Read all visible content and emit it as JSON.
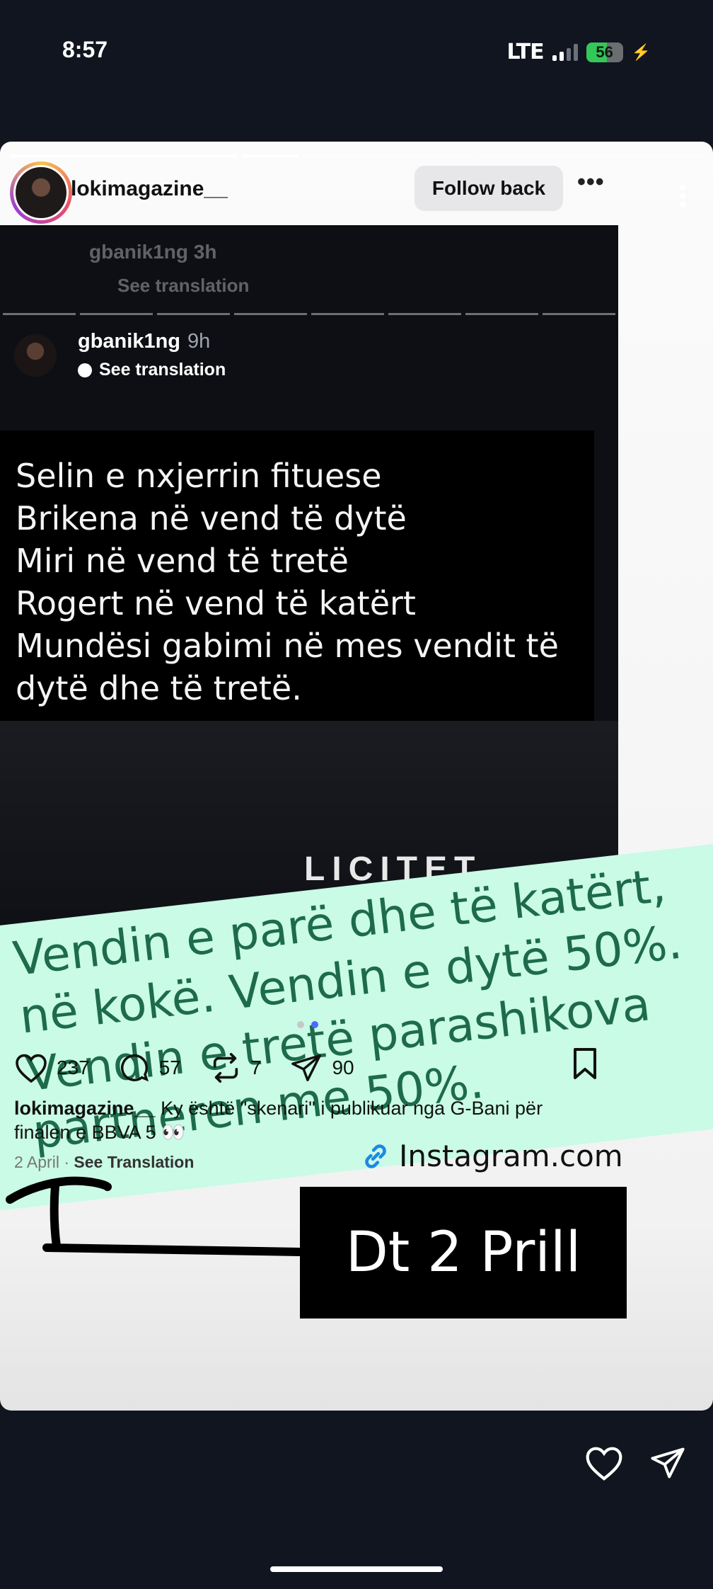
{
  "status_bar": {
    "time": "8:57",
    "network": "LTE",
    "battery": "56"
  },
  "story": {
    "username": "lokimagazine__",
    "follow_back_label": "Follow back",
    "more_label": "•••"
  },
  "embedded": {
    "ghost_username": "gbanik1ng",
    "ghost_time": "3h",
    "ghost_translate": "See translation",
    "username": "gbanik1ng",
    "time": "9h",
    "translate": "See translation",
    "lines": [
      "Selin e nxjerrin fituese",
      "Brikena në vend të dytë",
      "Miri në vend të tretë",
      "Rogert në vend të katërt",
      "Mundësi gabimi në mes vendit të",
      "dytë dhe të tretë."
    ],
    "background_word": "LICITET"
  },
  "overlay_text": [
    "Vendin e parë dhe të katërt,",
    "në kokë. Vendin e dytë 50%.",
    "Vendin e tretë parashikova",
    "partneren me 50%."
  ],
  "post": {
    "likes": "237",
    "comments": "57",
    "reposts": "7",
    "shares": "90",
    "caption_user": "lokimagazine__",
    "caption_text": "Ky është \"skenari\" i publikuar nga G-Bani për finalen e BBVA 5 👀",
    "date": "2 April",
    "separator": "·",
    "see_translation": "See Translation",
    "link_text": "Instagram.com",
    "date_label": "Dt 2 Prill"
  },
  "colors": {
    "overlay_bg": "#c9fbe6",
    "overlay_text": "#1d6b4a",
    "link_icon": "#1e88e5",
    "active_dot": "#4a6cf7"
  }
}
